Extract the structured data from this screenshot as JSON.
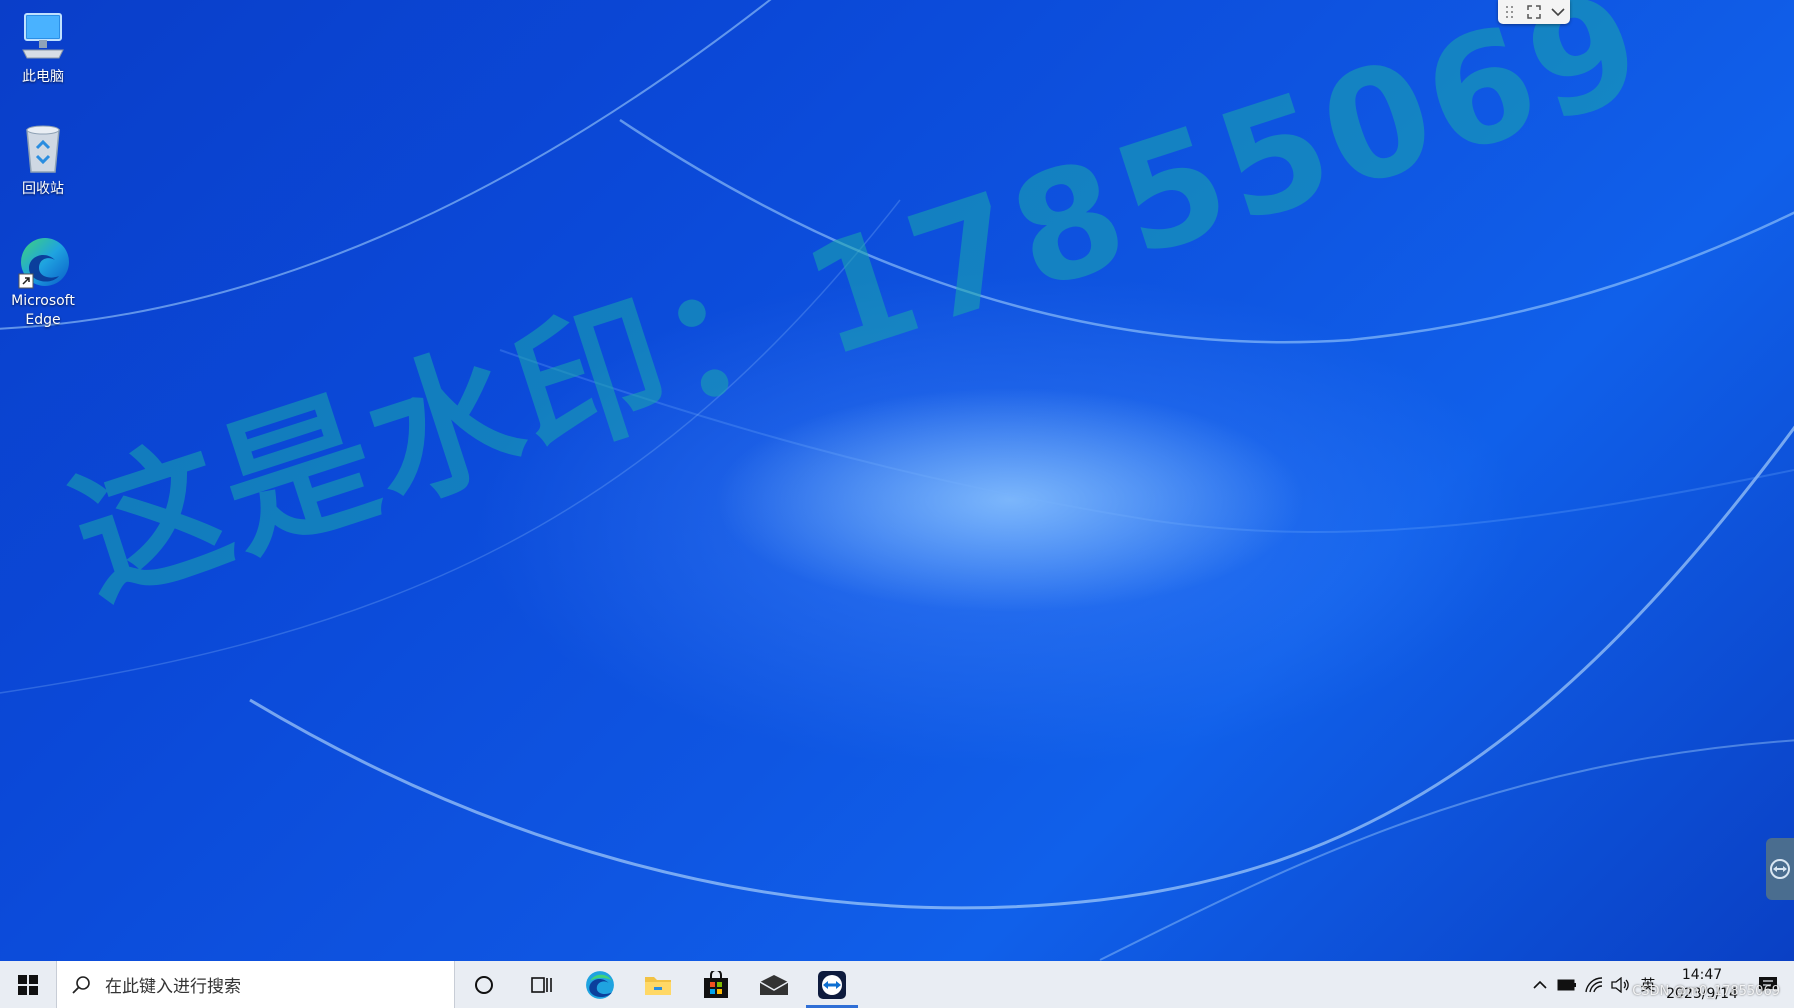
{
  "desktop": {
    "icons": [
      {
        "label": "此电脑",
        "icon": "computer-icon"
      },
      {
        "label": "回收站",
        "icon": "recycle-bin-icon"
      },
      {
        "label": "Microsoft\nEdge",
        "icon": "edge-icon"
      }
    ],
    "watermark": "这是水印：17855069"
  },
  "remote_toolbar": {
    "icons": [
      "drag-handle-icon",
      "fullscreen-icon",
      "chevron-down-icon"
    ]
  },
  "taskbar": {
    "search_placeholder": "在此键入进行搜索",
    "apps": [
      "cortana-icon",
      "task-view-icon",
      "edge-icon",
      "file-explorer-icon",
      "microsoft-store-icon",
      "mail-icon",
      "teamviewer-icon"
    ],
    "active_app": "teamviewer-icon",
    "tray": {
      "language": "英",
      "time": "14:47",
      "date": "2023/9/14",
      "overlay_text": "CSDN @m0_17855069"
    }
  },
  "colors": {
    "accent": "#2f6fd6",
    "watermark": "#19aaaa",
    "taskbar": "#e9edf3"
  }
}
